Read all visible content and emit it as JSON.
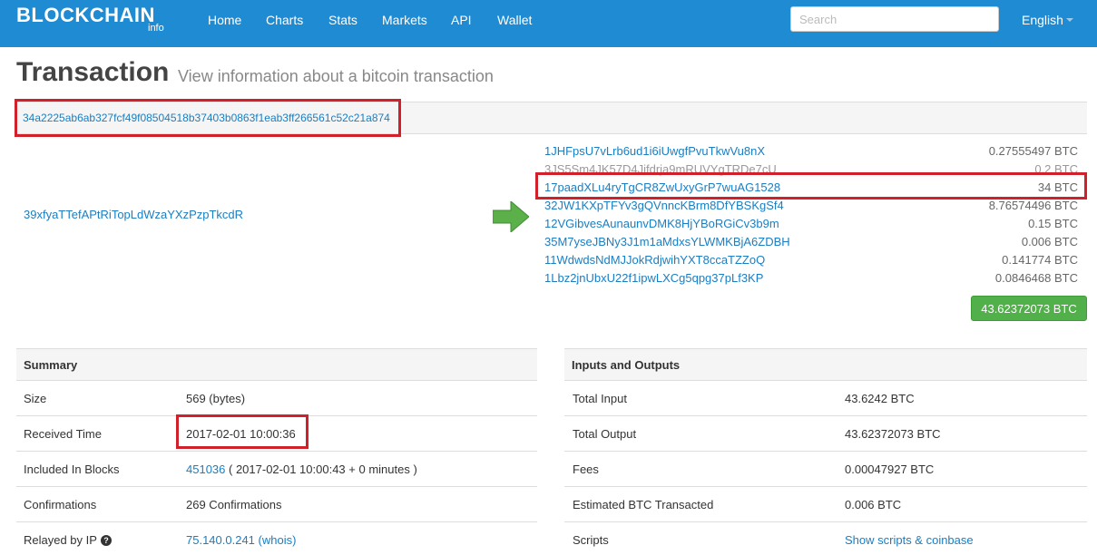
{
  "brand": {
    "name": "BLOCKCHAIN",
    "sub": "info"
  },
  "nav": {
    "items": [
      "Home",
      "Charts",
      "Stats",
      "Markets",
      "API",
      "Wallet"
    ],
    "search_placeholder": "Search",
    "language": "English"
  },
  "page": {
    "title": "Transaction",
    "subtitle": "View information about a bitcoin transaction"
  },
  "tx": {
    "hash": "34a2225ab6ab327fcf49f08504518b37403b0863f1eab3ff266561c52c21a874",
    "input": "39xfyaTTefAPtRiTopLdWzaYXzPzpTkcdR",
    "outputs": [
      {
        "address": "1JHFpsU7vLrb6ud1i6iUwgfPvuTkwVu8nX",
        "amount": "0.27555497 BTC"
      },
      {
        "address": "3JS5Sm4JK57D4Jifdrja9mRUVYgTRDe7cU",
        "amount": "0.2 BTC"
      },
      {
        "address": "17paadXLu4ryTgCR8ZwUxyGrP7wuAG1528",
        "amount": "34 BTC"
      },
      {
        "address": "32JW1KXpTFYv3gQVnncKBrm8DfYBSKgSf4",
        "amount": "8.76574496 BTC"
      },
      {
        "address": "12VGibvesAunaunvDMK8HjYBoRGiCv3b9m",
        "amount": "0.15 BTC"
      },
      {
        "address": "35M7yseJBNy3J1m1aMdxsYLWMKBjA6ZDBH",
        "amount": "0.006 BTC"
      },
      {
        "address": "11WdwdsNdMJJokRdjwihYXT8ccaTZZoQ",
        "amount": "0.141774 BTC"
      },
      {
        "address": "1Lbz2jnUbxU22f1ipwLXCg5qpg37pLf3KP",
        "amount": "0.0846468 BTC"
      }
    ],
    "total": "43.62372073 BTC"
  },
  "summary": {
    "header": "Summary",
    "rows": [
      {
        "key": "Size",
        "value": "569 (bytes)"
      },
      {
        "key": "Received Time",
        "value": "2017-02-01 10:00:36"
      },
      {
        "key": "Included In Blocks",
        "block": "451036",
        "value": " ( 2017-02-01 10:00:43 + 0 minutes )"
      },
      {
        "key": "Confirmations",
        "value": "269 Confirmations"
      },
      {
        "key": "Relayed by IP",
        "value": "75.140.0.241 (whois)"
      }
    ]
  },
  "io": {
    "header": "Inputs and Outputs",
    "rows": [
      {
        "key": "Total Input",
        "value": "43.6242 BTC"
      },
      {
        "key": "Total Output",
        "value": "43.62372073 BTC"
      },
      {
        "key": "Fees",
        "value": "0.00047927 BTC"
      },
      {
        "key": "Estimated BTC Transacted",
        "value": "0.006 BTC"
      },
      {
        "key": "Scripts",
        "value": "Show scripts & coinbase"
      }
    ]
  },
  "colors": {
    "nav": "#1e8bd3",
    "link": "#1a7ec2",
    "button": "#52b04a",
    "highlight": "#d0202a"
  }
}
